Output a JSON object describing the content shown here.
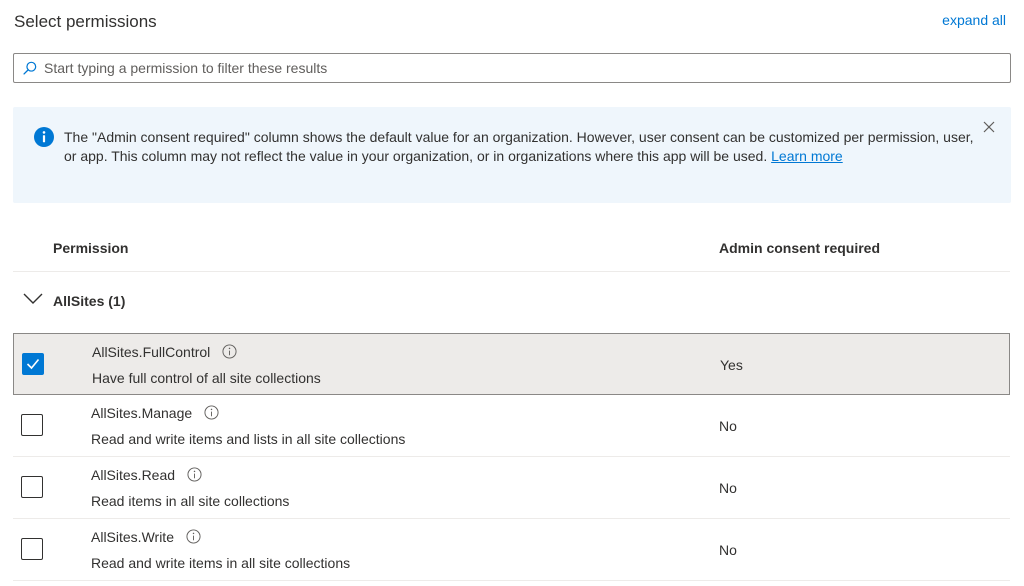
{
  "header": {
    "title": "Select permissions",
    "expand_all": "expand all"
  },
  "search": {
    "placeholder": "Start typing a permission to filter these results",
    "value": ""
  },
  "info": {
    "text": "The \"Admin consent required\" column shows the default value for an organization. However, user consent can be customized per permission, user, or app. This column may not reflect the value in your organization, or in organizations where this app will be used.",
    "link": "Learn more",
    "accent_color": "#0078d4"
  },
  "columns": {
    "permission": "Permission",
    "consent": "Admin consent required"
  },
  "group": {
    "label": "AllSites (1)",
    "expanded": true
  },
  "permissions": [
    {
      "name": "AllSites.FullControl",
      "description": "Have full control of all site collections",
      "consent": "Yes",
      "checked": true
    },
    {
      "name": "AllSites.Manage",
      "description": "Read and write items and lists in all site collections",
      "consent": "No",
      "checked": false
    },
    {
      "name": "AllSites.Read",
      "description": "Read items in all site collections",
      "consent": "No",
      "checked": false
    },
    {
      "name": "AllSites.Write",
      "description": "Read and write items in all site collections",
      "consent": "No",
      "checked": false
    }
  ]
}
